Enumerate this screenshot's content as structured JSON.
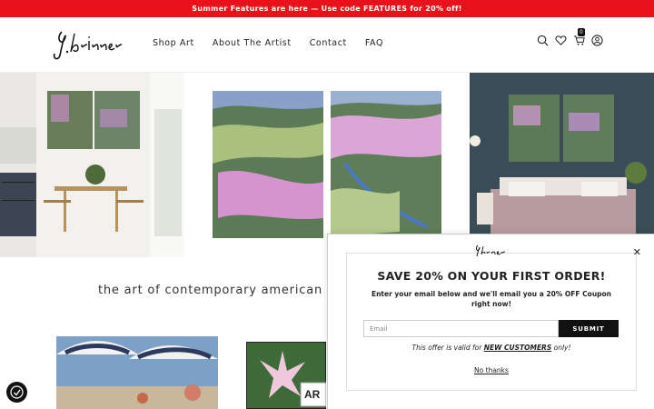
{
  "promo": {
    "text": "Summer Features are here — Use code FEATURES for 20% off!"
  },
  "nav": {
    "items": [
      "Shop Art",
      "About The Artist",
      "Contact",
      "FAQ"
    ]
  },
  "cart": {
    "count": "0"
  },
  "tagline": "the art of contemporary american exp",
  "popup": {
    "title": "SAVE 20% ON YOUR FIRST ORDER!",
    "body": "Enter your email below and we'll email you a 20% OFF Coupon right now!",
    "email_placeholder": "Email",
    "submit_label": "SUBMIT",
    "note_prefix": "This offer is valid for ",
    "note_link": "NEW CUSTOMERS",
    "note_suffix": " only!",
    "no_thanks": "No thanks",
    "close": "✕"
  },
  "colors": {
    "promo_bg": "#e8121a",
    "button_bg": "#111111"
  },
  "icons": [
    "search-icon",
    "heart-icon",
    "cart-icon",
    "account-icon",
    "accessibility-icon",
    "close-icon"
  ]
}
